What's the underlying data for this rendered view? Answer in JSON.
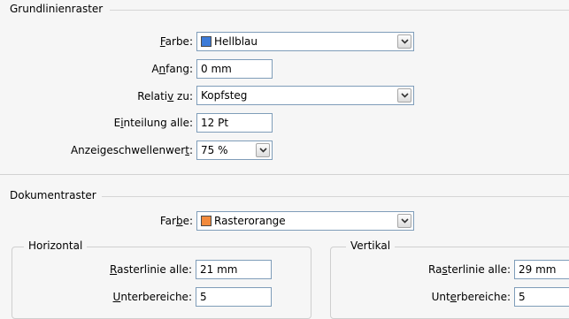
{
  "baseline_grid": {
    "title": "Grundlinienraster",
    "color": {
      "label_pre": "",
      "label_key": "F",
      "label_post": "arbe:",
      "value": "Hellblau",
      "swatch": "#3c7bd8"
    },
    "start": {
      "label_pre": "A",
      "label_key": "n",
      "label_post": "fang:",
      "value": "0 mm"
    },
    "relative_to": {
      "label_pre": "Relati",
      "label_key": "v",
      "label_post": " zu:",
      "value": "Kopfsteg"
    },
    "increment": {
      "label_pre": "E",
      "label_key": "i",
      "label_post": "nteilung alle:",
      "value": "12 Pt"
    },
    "view_threshold": {
      "label_pre": "Anzeigeschwellenwer",
      "label_key": "t",
      "label_post": ":",
      "value": "75 %"
    }
  },
  "document_grid": {
    "title": "Dokumentraster",
    "color": {
      "label_pre": "Far",
      "label_key": "b",
      "label_post": "e:",
      "value": "Rasterorange",
      "swatch": "#f28a3c"
    },
    "horizontal": {
      "title": "Horizontal",
      "gridline": {
        "label_pre": "",
        "label_key": "R",
        "label_post": "asterlinie alle:",
        "value": "21 mm"
      },
      "subdivisions": {
        "label_pre": "",
        "label_key": "U",
        "label_post": "nterbereiche:",
        "value": "5"
      }
    },
    "vertical": {
      "title": "Vertikal",
      "gridline": {
        "label_pre": "Ra",
        "label_key": "s",
        "label_post": "terlinie alle:",
        "value": "29 mm"
      },
      "subdivisions": {
        "label_pre": "Unt",
        "label_key": "e",
        "label_post": "rbereiche:",
        "value": "5"
      }
    }
  },
  "icons": {
    "dropdown": "chevron-down-icon"
  }
}
